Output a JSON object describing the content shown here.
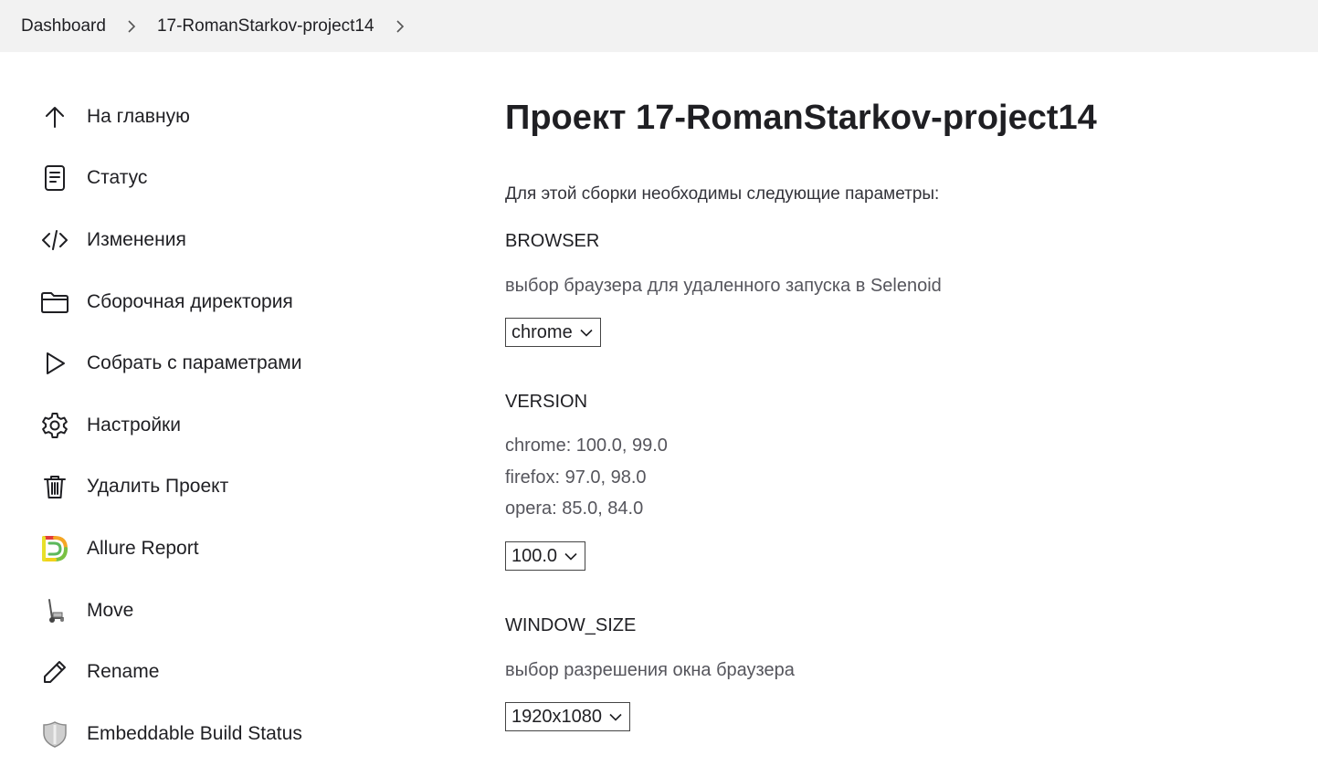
{
  "breadcrumb": {
    "items": [
      "Dashboard",
      "17-RomanStarkov-project14"
    ]
  },
  "sidebar": {
    "items": [
      {
        "label": "На главную",
        "icon": "arrow-up-icon"
      },
      {
        "label": "Статус",
        "icon": "document-icon"
      },
      {
        "label": "Изменения",
        "icon": "code-icon"
      },
      {
        "label": "Сборочная директория",
        "icon": "folder-icon"
      },
      {
        "label": "Собрать с параметрами",
        "icon": "play-icon"
      },
      {
        "label": "Настройки",
        "icon": "gear-icon"
      },
      {
        "label": "Удалить Проект",
        "icon": "trash-icon"
      },
      {
        "label": "Allure Report",
        "icon": "allure-logo-icon"
      },
      {
        "label": "Move",
        "icon": "hand-truck-icon"
      },
      {
        "label": "Rename",
        "icon": "pencil-icon"
      },
      {
        "label": "Embeddable Build Status",
        "icon": "shield-icon"
      }
    ]
  },
  "main": {
    "title": "Проект 17-RomanStarkov-project14",
    "intro": "Для этой сборки необходимы следующие параметры:",
    "params": [
      {
        "name": "BROWSER",
        "description": [
          "выбор браузера для удаленного запуска в Selenoid"
        ],
        "selected": "chrome"
      },
      {
        "name": "VERSION",
        "description": [
          "chrome: 100.0, 99.0",
          "firefox: 97.0, 98.0",
          "opera: 85.0, 84.0"
        ],
        "selected": "100.0"
      },
      {
        "name": "WINDOW_SIZE",
        "description": [
          "выбор разрешения окна браузера"
        ],
        "selected": "1920x1080"
      }
    ]
  },
  "colors": {
    "breadcrumb_bg": "#f2f2f2",
    "text": "#1f1f23",
    "muted_text": "#55555c"
  }
}
